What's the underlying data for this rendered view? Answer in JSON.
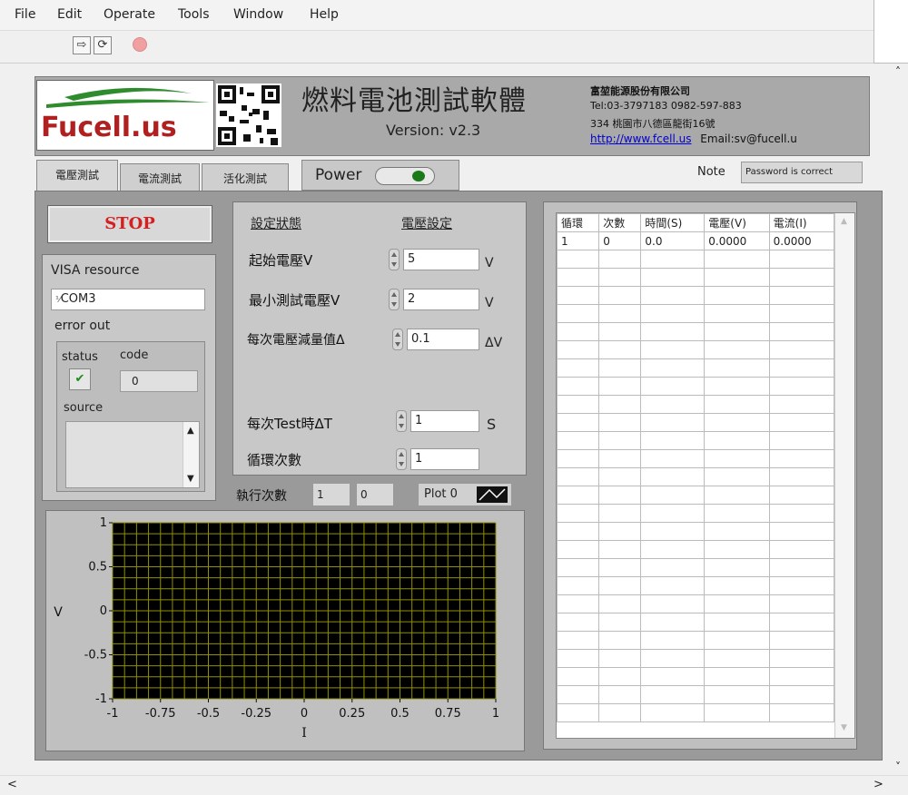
{
  "menu": [
    "File",
    "Edit",
    "Operate",
    "Tools",
    "Window",
    "Help"
  ],
  "header": {
    "logo_text": "Fucell.us",
    "title": "燃料電池測試軟體",
    "version": "Version: v2.3",
    "company_name": "富堃能源股份有限公司",
    "company_tel": "Tel:03-3797183    0982-597-883",
    "company_addr": "334 桃園市八德區龍街16號",
    "company_url": "http://www.fcell.us",
    "company_email": "Email:sv@fucell.u"
  },
  "tabs": [
    "電壓測試",
    "電流測試",
    "活化測試"
  ],
  "power_label": "Power",
  "note": {
    "label": "Note",
    "value": "Password is correct"
  },
  "left": {
    "stop_label": "STOP",
    "visa_label": "VISA resource",
    "visa_value": "COM3",
    "error_out": "error out",
    "status_label": "status",
    "code_label": "code",
    "code_value": "0",
    "source_label": "source"
  },
  "settings": {
    "header_left": "設定狀態",
    "header_right": "電壓設定",
    "rows": [
      {
        "label": "起始電壓V",
        "value": "5",
        "unit": "V"
      },
      {
        "label": "最小測試電壓V",
        "value": "2",
        "unit": "V"
      },
      {
        "label": "每次電壓減量值Δ",
        "value": "0.1",
        "unit": "ΔV"
      },
      {
        "label": "每次Test時ΔT",
        "value": "1",
        "unit": "S"
      },
      {
        "label": "循環次數",
        "value": "1",
        "unit": ""
      }
    ],
    "exec_label": "執行次數",
    "exec_value1": "1",
    "exec_value2": "0",
    "plot_label": "Plot 0"
  },
  "graph": {
    "ylabel": "V",
    "xlabel": "I",
    "yticks": [
      "1",
      "0.5",
      "0",
      "-0.5",
      "-1"
    ],
    "xticks": [
      "-1",
      "-0.75",
      "-0.5",
      "-0.25",
      "0",
      "0.25",
      "0.5",
      "0.75",
      "1"
    ],
    "xlim": [
      -1,
      1
    ],
    "ylim": [
      -1,
      1
    ],
    "bg_color": "#000000",
    "grid_color": "#8f8f00"
  },
  "table": {
    "headers": [
      "循環",
      "次數",
      "時間(S)",
      "電壓(V)",
      "電流(I)"
    ],
    "rows": [
      [
        "1",
        "0",
        "0.0",
        "0.0000",
        "0.0000"
      ]
    ]
  }
}
